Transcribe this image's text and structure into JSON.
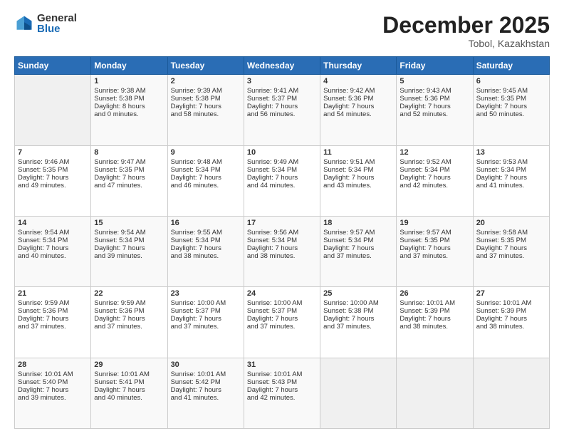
{
  "header": {
    "logo_general": "General",
    "logo_blue": "Blue",
    "month_title": "December 2025",
    "location": "Tobol, Kazakhstan"
  },
  "weekdays": [
    "Sunday",
    "Monday",
    "Tuesday",
    "Wednesday",
    "Thursday",
    "Friday",
    "Saturday"
  ],
  "weeks": [
    [
      {
        "day": null,
        "content": null
      },
      {
        "day": "1",
        "sunrise": "Sunrise: 9:38 AM",
        "sunset": "Sunset: 5:38 PM",
        "daylight": "Daylight: 8 hours",
        "minutes": "and 0 minutes."
      },
      {
        "day": "2",
        "sunrise": "Sunrise: 9:39 AM",
        "sunset": "Sunset: 5:38 PM",
        "daylight": "Daylight: 7 hours",
        "minutes": "and 58 minutes."
      },
      {
        "day": "3",
        "sunrise": "Sunrise: 9:41 AM",
        "sunset": "Sunset: 5:37 PM",
        "daylight": "Daylight: 7 hours",
        "minutes": "and 56 minutes."
      },
      {
        "day": "4",
        "sunrise": "Sunrise: 9:42 AM",
        "sunset": "Sunset: 5:36 PM",
        "daylight": "Daylight: 7 hours",
        "minutes": "and 54 minutes."
      },
      {
        "day": "5",
        "sunrise": "Sunrise: 9:43 AM",
        "sunset": "Sunset: 5:36 PM",
        "daylight": "Daylight: 7 hours",
        "minutes": "and 52 minutes."
      },
      {
        "day": "6",
        "sunrise": "Sunrise: 9:45 AM",
        "sunset": "Sunset: 5:35 PM",
        "daylight": "Daylight: 7 hours",
        "minutes": "and 50 minutes."
      }
    ],
    [
      {
        "day": "7",
        "sunrise": "Sunrise: 9:46 AM",
        "sunset": "Sunset: 5:35 PM",
        "daylight": "Daylight: 7 hours",
        "minutes": "and 49 minutes."
      },
      {
        "day": "8",
        "sunrise": "Sunrise: 9:47 AM",
        "sunset": "Sunset: 5:35 PM",
        "daylight": "Daylight: 7 hours",
        "minutes": "and 47 minutes."
      },
      {
        "day": "9",
        "sunrise": "Sunrise: 9:48 AM",
        "sunset": "Sunset: 5:34 PM",
        "daylight": "Daylight: 7 hours",
        "minutes": "and 46 minutes."
      },
      {
        "day": "10",
        "sunrise": "Sunrise: 9:49 AM",
        "sunset": "Sunset: 5:34 PM",
        "daylight": "Daylight: 7 hours",
        "minutes": "and 44 minutes."
      },
      {
        "day": "11",
        "sunrise": "Sunrise: 9:51 AM",
        "sunset": "Sunset: 5:34 PM",
        "daylight": "Daylight: 7 hours",
        "minutes": "and 43 minutes."
      },
      {
        "day": "12",
        "sunrise": "Sunrise: 9:52 AM",
        "sunset": "Sunset: 5:34 PM",
        "daylight": "Daylight: 7 hours",
        "minutes": "and 42 minutes."
      },
      {
        "day": "13",
        "sunrise": "Sunrise: 9:53 AM",
        "sunset": "Sunset: 5:34 PM",
        "daylight": "Daylight: 7 hours",
        "minutes": "and 41 minutes."
      }
    ],
    [
      {
        "day": "14",
        "sunrise": "Sunrise: 9:54 AM",
        "sunset": "Sunset: 5:34 PM",
        "daylight": "Daylight: 7 hours",
        "minutes": "and 40 minutes."
      },
      {
        "day": "15",
        "sunrise": "Sunrise: 9:54 AM",
        "sunset": "Sunset: 5:34 PM",
        "daylight": "Daylight: 7 hours",
        "minutes": "and 39 minutes."
      },
      {
        "day": "16",
        "sunrise": "Sunrise: 9:55 AM",
        "sunset": "Sunset: 5:34 PM",
        "daylight": "Daylight: 7 hours",
        "minutes": "and 38 minutes."
      },
      {
        "day": "17",
        "sunrise": "Sunrise: 9:56 AM",
        "sunset": "Sunset: 5:34 PM",
        "daylight": "Daylight: 7 hours",
        "minutes": "and 38 minutes."
      },
      {
        "day": "18",
        "sunrise": "Sunrise: 9:57 AM",
        "sunset": "Sunset: 5:34 PM",
        "daylight": "Daylight: 7 hours",
        "minutes": "and 37 minutes."
      },
      {
        "day": "19",
        "sunrise": "Sunrise: 9:57 AM",
        "sunset": "Sunset: 5:35 PM",
        "daylight": "Daylight: 7 hours",
        "minutes": "and 37 minutes."
      },
      {
        "day": "20",
        "sunrise": "Sunrise: 9:58 AM",
        "sunset": "Sunset: 5:35 PM",
        "daylight": "Daylight: 7 hours",
        "minutes": "and 37 minutes."
      }
    ],
    [
      {
        "day": "21",
        "sunrise": "Sunrise: 9:59 AM",
        "sunset": "Sunset: 5:36 PM",
        "daylight": "Daylight: 7 hours",
        "minutes": "and 37 minutes."
      },
      {
        "day": "22",
        "sunrise": "Sunrise: 9:59 AM",
        "sunset": "Sunset: 5:36 PM",
        "daylight": "Daylight: 7 hours",
        "minutes": "and 37 minutes."
      },
      {
        "day": "23",
        "sunrise": "Sunrise: 10:00 AM",
        "sunset": "Sunset: 5:37 PM",
        "daylight": "Daylight: 7 hours",
        "minutes": "and 37 minutes."
      },
      {
        "day": "24",
        "sunrise": "Sunrise: 10:00 AM",
        "sunset": "Sunset: 5:37 PM",
        "daylight": "Daylight: 7 hours",
        "minutes": "and 37 minutes."
      },
      {
        "day": "25",
        "sunrise": "Sunrise: 10:00 AM",
        "sunset": "Sunset: 5:38 PM",
        "daylight": "Daylight: 7 hours",
        "minutes": "and 37 minutes."
      },
      {
        "day": "26",
        "sunrise": "Sunrise: 10:01 AM",
        "sunset": "Sunset: 5:39 PM",
        "daylight": "Daylight: 7 hours",
        "minutes": "and 38 minutes."
      },
      {
        "day": "27",
        "sunrise": "Sunrise: 10:01 AM",
        "sunset": "Sunset: 5:39 PM",
        "daylight": "Daylight: 7 hours",
        "minutes": "and 38 minutes."
      }
    ],
    [
      {
        "day": "28",
        "sunrise": "Sunrise: 10:01 AM",
        "sunset": "Sunset: 5:40 PM",
        "daylight": "Daylight: 7 hours",
        "minutes": "and 39 minutes."
      },
      {
        "day": "29",
        "sunrise": "Sunrise: 10:01 AM",
        "sunset": "Sunset: 5:41 PM",
        "daylight": "Daylight: 7 hours",
        "minutes": "and 40 minutes."
      },
      {
        "day": "30",
        "sunrise": "Sunrise: 10:01 AM",
        "sunset": "Sunset: 5:42 PM",
        "daylight": "Daylight: 7 hours",
        "minutes": "and 41 minutes."
      },
      {
        "day": "31",
        "sunrise": "Sunrise: 10:01 AM",
        "sunset": "Sunset: 5:43 PM",
        "daylight": "Daylight: 7 hours",
        "minutes": "and 42 minutes."
      },
      {
        "day": null,
        "content": null
      },
      {
        "day": null,
        "content": null
      },
      {
        "day": null,
        "content": null
      }
    ]
  ]
}
